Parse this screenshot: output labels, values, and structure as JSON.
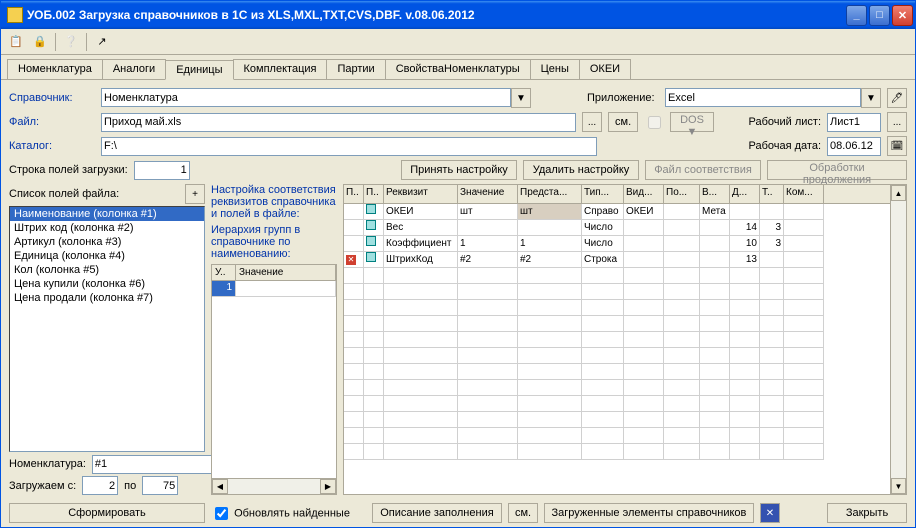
{
  "window": {
    "title": "УОБ.002 Загрузка справочников в 1С из XLS,MXL,TXT,CVS,DBF. v.08.06.2012"
  },
  "tabs": [
    "Номенклатура",
    "Аналоги",
    "Единицы",
    "Комплектация",
    "Партии",
    "СвойстваНоменклатуры",
    "Цены",
    "ОКЕИ"
  ],
  "active_tab": 2,
  "labels": {
    "spravochnik": "Справочник:",
    "prilozhenie": "Приложение:",
    "fajl": "Файл:",
    "sm": "см.",
    "dos": "DOS",
    "rabochij_list": "Рабочий лист:",
    "katalog": "Каталог:",
    "rabochaya_data": "Рабочая дата:",
    "stroka_polej": "Строка полей загрузки:",
    "prinyat": "Принять настройку",
    "udalit": "Удалить настройку",
    "fajl_soot": "Файл соответствия",
    "obrabotki": "Обработки продолжения",
    "spisok_polej": "Список полей файла:",
    "plus": "+",
    "nastrojka": "Настройка соответствия реквизитов справочника и полей в файле:",
    "ierarhiya": "Иерархия групп в справочнике по наименованию:",
    "nomenklatura_num": "Номенклатура:",
    "num_value": "#1",
    "zagruzhaem": "Загружаем с:",
    "s_val": "2",
    "po": "по",
    "po_val": "75",
    "sformirovat": "Сформировать",
    "obnovlyat": "Обновлять найденные",
    "opisanie": "Описание заполнения",
    "zagruzhennye": "Загруженные элементы справочников",
    "zakryt": "Закрыть",
    "dots": "...",
    "dropdown": "▼"
  },
  "smalltable": {
    "h1": "У..",
    "h2": "Значение",
    "row1": "1"
  },
  "fields": {
    "spravochnik": "Номенклатура",
    "prilozhenie": "Excel",
    "fajl": "Приход май.xls",
    "list": "Лист1",
    "katalog": "F:\\",
    "data": "08.06.12",
    "stroka": "1"
  },
  "file_fields": [
    "Наименование (колонка #1)",
    "Штрих код (колонка #2)",
    "Артикул (колонка #3)",
    "Единица (колонка #4)",
    "Кол (колонка #5)",
    "Цена купили (колонка #6)",
    "Цена продали (колонка #7)"
  ],
  "gridheaders": [
    "П..",
    "П..",
    "Реквизит",
    "Значение",
    "Предста...",
    "Тип...",
    "Вид...",
    "По...",
    "В...",
    "Д...",
    "Т..",
    "Ком..."
  ],
  "gridrows": [
    {
      "c2": "sq",
      "req": "ОКЕИ",
      "zn": "шт",
      "pr": "шт",
      "tip": "Справо",
      "vid": "ОКЕИ",
      "po": "",
      "v": "Мета",
      "d": "",
      "t": "",
      "kom": ""
    },
    {
      "c2": "sq",
      "req": "Вес",
      "zn": "",
      "pr": "",
      "tip": "Число",
      "vid": "",
      "po": "",
      "v": "",
      "d": "14",
      "t": "3",
      "kom": ""
    },
    {
      "c2": "sq",
      "req": "Коэффициент",
      "zn": "1",
      "pr": "1",
      "tip": "Число",
      "vid": "",
      "po": "",
      "v": "",
      "d": "10",
      "t": "3",
      "kom": ""
    },
    {
      "c1": "x",
      "c2": "sq",
      "req": "ШтрихКод",
      "zn": "#2",
      "pr": "#2",
      "tip": "Строка",
      "vid": "",
      "po": "",
      "v": "",
      "d": "13",
      "t": "",
      "kom": ""
    }
  ]
}
